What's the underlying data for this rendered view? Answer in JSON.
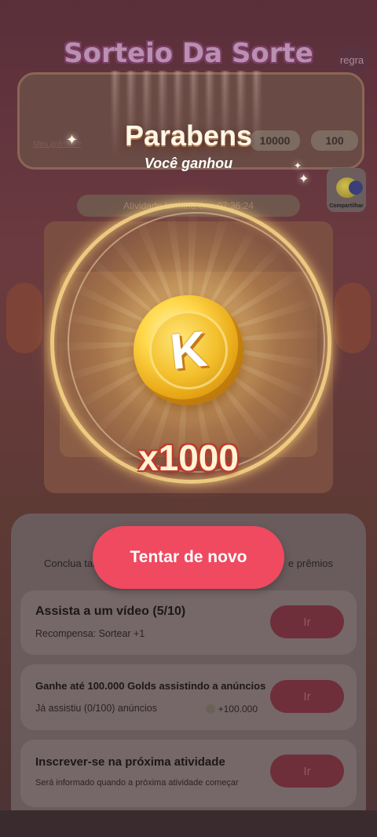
{
  "background": {
    "title": "Sorteio Da Sorte",
    "rule_label": "regra",
    "my_prizes_link": "Meu prêmio >",
    "chips": [
      "10000",
      "100"
    ],
    "share_label": "Compartilhar",
    "activity_text": "Atividade termina em: 07:36:24",
    "tasks_intro_left": "Conclua tarefas",
    "tasks_intro_right": "e prêmios",
    "tasks": [
      {
        "title": "Assista a um vídeo (5/10)",
        "subtitle": "Recompensa: Sortear +1",
        "reward": "",
        "button": "Ir"
      },
      {
        "title": "Ganhe até 100.000 Golds assistindo a anúncios",
        "subtitle": "Já assistiu (0/100) anúncios",
        "reward": "+100.000",
        "button": "Ir"
      },
      {
        "title": "Inscrever-se na próxima atividade",
        "subtitle": "Será informado quando a próxima atividade começar",
        "reward": "",
        "button": "Ir"
      }
    ]
  },
  "popup": {
    "congrats": "Parabens",
    "you_won": "Você ganhou",
    "coin_letter": "K",
    "amount": "x1000",
    "retry_button": "Tentar de novo"
  },
  "colors": {
    "retry_button": "#ef4a60",
    "coin_gold": "#ffd84a",
    "ring_glow": "#ffde8c"
  },
  "icons": {
    "coin": "gold-k-coin-icon",
    "sparkle": "sparkle-icon",
    "reward_coin": "coin-icon"
  }
}
